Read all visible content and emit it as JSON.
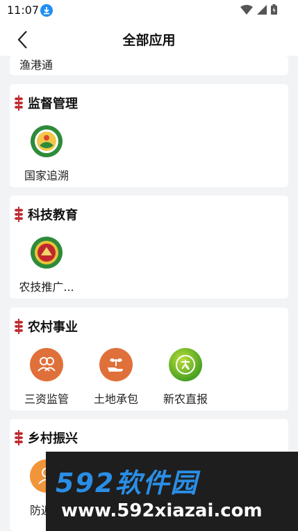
{
  "status": {
    "time": "11:07"
  },
  "header": {
    "title": "全部应用"
  },
  "top_app": {
    "label": "渔港通"
  },
  "sections": [
    {
      "title": "监督管理",
      "apps": [
        {
          "label": "国家追溯",
          "icon": "national-trace-logo-icon"
        }
      ]
    },
    {
      "title": "科技教育",
      "apps": [
        {
          "label": "农技推广...",
          "icon": "agri-tech-logo-icon"
        }
      ]
    },
    {
      "title": "农村事业",
      "apps": [
        {
          "label": "三资监管",
          "icon": "people-icon"
        },
        {
          "label": "土地承包",
          "icon": "sprout-hand-icon"
        },
        {
          "label": "新农直报",
          "icon": "nong-badge-icon"
        }
      ]
    },
    {
      "title": "乡村振兴",
      "apps": [
        {
          "label": "防返贫",
          "icon": "person-icon"
        }
      ]
    }
  ],
  "watermark": {
    "brand": "592软件园",
    "url": "www.592xiazai.com"
  },
  "colors": {
    "accent_orange": "#e0703a",
    "wheat_red": "#c0282d",
    "green_badge": "#2e8b3a",
    "brand_blue": "#2a8ee6"
  }
}
